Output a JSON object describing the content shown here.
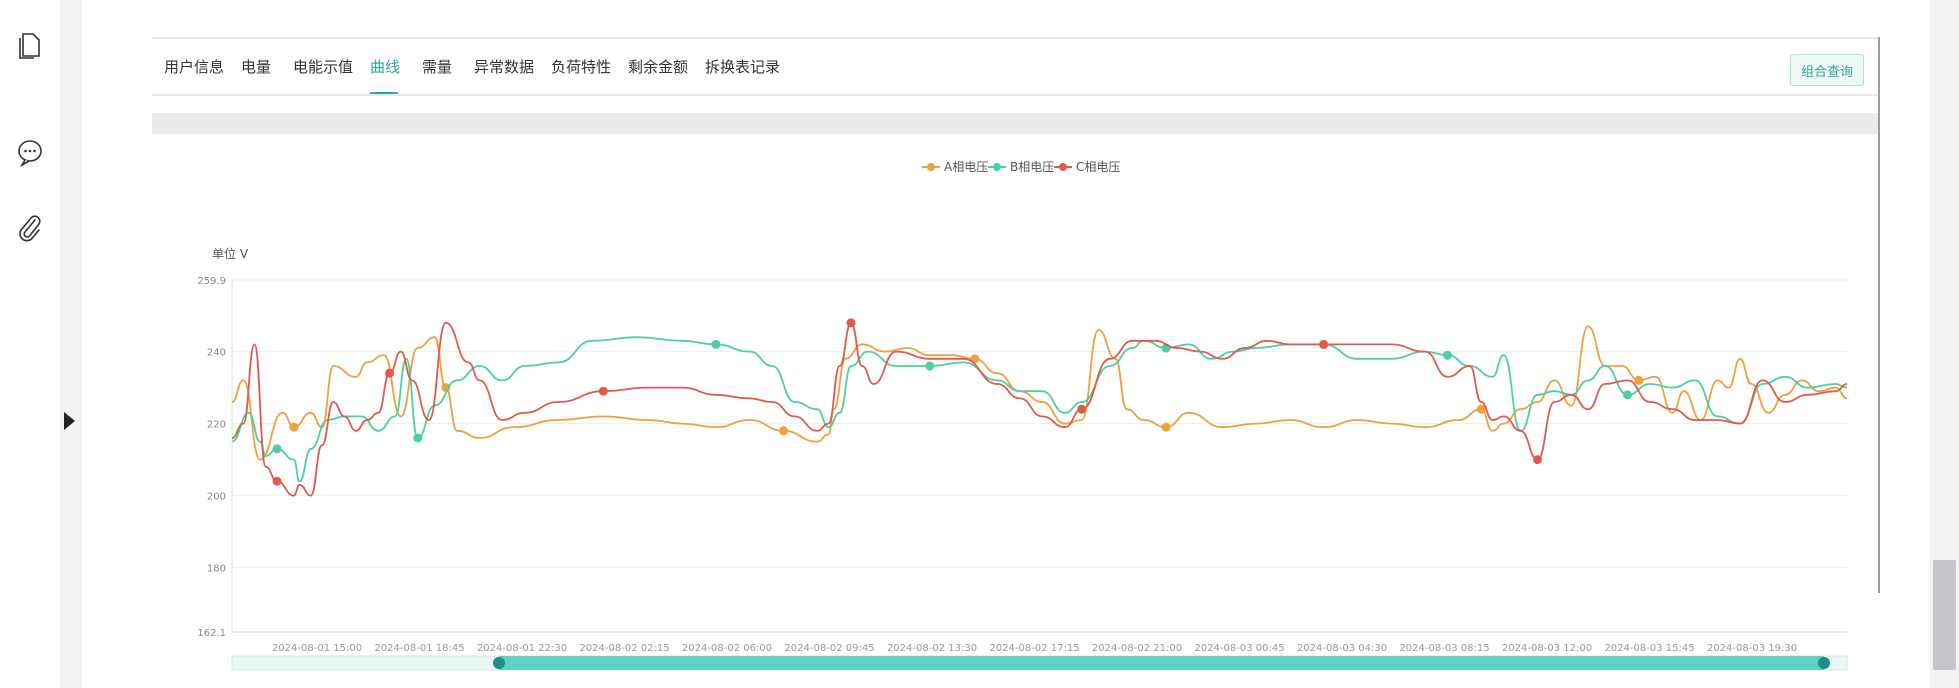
{
  "tabs": [
    {
      "label": "用户信息",
      "active": false
    },
    {
      "label": "电量",
      "active": false
    },
    {
      "label": "电能示值",
      "active": false
    },
    {
      "label": "曲线",
      "active": true
    },
    {
      "label": "需量",
      "active": false
    },
    {
      "label": "异常数据",
      "active": false
    },
    {
      "label": "负荷特性",
      "active": false
    },
    {
      "label": "剩余金额",
      "active": false
    },
    {
      "label": "拆换表记录",
      "active": false
    }
  ],
  "query_button": "组合查询",
  "rail_icons": [
    "document-icon",
    "chat-icon",
    "paperclip-icon"
  ],
  "colors": {
    "accent": "#2ea89c",
    "phase_a": "#f0a03c",
    "phase_b": "#4ccfa3",
    "phase_c": "#e05a4e"
  },
  "chart_data": {
    "type": "line",
    "unit_label": "单位 V",
    "ylim": [
      162.1,
      259.9
    ],
    "y_ticks": [
      "259.9",
      "240",
      "220",
      "200",
      "180",
      "162.1"
    ],
    "x_ticks": [
      "2024-08-01 15:00",
      "2024-08-01 18:45",
      "2024-08-01 22:30",
      "2024-08-02 02:15",
      "2024-08-02 06:00",
      "2024-08-02 09:45",
      "2024-08-02 13:30",
      "2024-08-02 17:15",
      "2024-08-02 21:00",
      "2024-08-03 00:45",
      "2024-08-03 04:30",
      "2024-08-03 08:15",
      "2024-08-03 12:00",
      "2024-08-03 15:45",
      "2024-08-03 19:30"
    ],
    "grid": true,
    "legend_position": "top-center",
    "series": [
      {
        "name": "A相电压",
        "color": "#f0a03c",
        "points": [
          [
            0,
            226
          ],
          [
            2,
            232
          ],
          [
            5,
            210
          ],
          [
            9,
            223
          ],
          [
            11,
            219
          ],
          [
            14,
            223
          ],
          [
            16,
            219
          ],
          [
            18,
            236
          ],
          [
            22,
            233
          ],
          [
            24,
            237
          ],
          [
            27,
            239
          ],
          [
            30,
            222
          ],
          [
            33,
            241
          ],
          [
            36,
            244
          ],
          [
            38,
            230
          ],
          [
            40,
            218
          ],
          [
            44,
            216
          ],
          [
            50,
            219
          ],
          [
            58,
            221
          ],
          [
            66,
            222
          ],
          [
            74,
            221
          ],
          [
            80,
            220
          ],
          [
            86,
            219
          ],
          [
            92,
            221
          ],
          [
            98,
            218
          ],
          [
            104,
            215
          ],
          [
            106,
            217
          ],
          [
            107,
            224
          ],
          [
            109,
            238
          ],
          [
            112,
            242
          ],
          [
            116,
            240
          ],
          [
            120,
            241
          ],
          [
            124,
            239
          ],
          [
            128,
            239
          ],
          [
            132,
            238
          ],
          [
            136,
            234
          ],
          [
            140,
            229
          ],
          [
            144,
            226
          ],
          [
            148,
            220
          ],
          [
            151,
            221
          ],
          [
            154,
            246
          ],
          [
            157,
            238
          ],
          [
            159,
            224
          ],
          [
            162,
            221
          ],
          [
            166,
            219
          ],
          [
            170,
            223
          ],
          [
            176,
            219
          ],
          [
            182,
            220
          ],
          [
            188,
            221
          ],
          [
            194,
            219
          ],
          [
            200,
            221
          ],
          [
            206,
            220
          ],
          [
            212,
            219
          ],
          [
            218,
            221
          ],
          [
            222,
            224
          ],
          [
            224,
            218
          ],
          [
            226,
            220
          ],
          [
            229,
            224
          ],
          [
            232,
            226
          ],
          [
            235,
            232
          ],
          [
            238,
            225
          ],
          [
            241,
            247
          ],
          [
            244,
            236
          ],
          [
            247,
            236
          ],
          [
            250,
            232
          ],
          [
            253,
            233
          ],
          [
            256,
            223
          ],
          [
            258,
            229
          ],
          [
            261,
            221
          ],
          [
            264,
            232
          ],
          [
            266,
            230
          ],
          [
            268,
            238
          ],
          [
            270,
            231
          ],
          [
            273,
            223
          ],
          [
            276,
            228
          ],
          [
            279,
            232
          ],
          [
            282,
            229
          ],
          [
            285,
            230
          ],
          [
            287,
            227
          ]
        ]
      },
      {
        "name": "B相电压",
        "color": "#4ccfa3",
        "points": [
          [
            0,
            215
          ],
          [
            3,
            223
          ],
          [
            5,
            215
          ],
          [
            6,
            211
          ],
          [
            8,
            213
          ],
          [
            11,
            210
          ],
          [
            12,
            204
          ],
          [
            14,
            213
          ],
          [
            17,
            221
          ],
          [
            20,
            222
          ],
          [
            23,
            222
          ],
          [
            26,
            218
          ],
          [
            29,
            222
          ],
          [
            31,
            238
          ],
          [
            33,
            216
          ],
          [
            36,
            225
          ],
          [
            40,
            232
          ],
          [
            44,
            236
          ],
          [
            48,
            232
          ],
          [
            52,
            236
          ],
          [
            58,
            237
          ],
          [
            64,
            243
          ],
          [
            72,
            244
          ],
          [
            80,
            243
          ],
          [
            86,
            242
          ],
          [
            92,
            240
          ],
          [
            96,
            236
          ],
          [
            100,
            226
          ],
          [
            104,
            224
          ],
          [
            106,
            219
          ],
          [
            108,
            223
          ],
          [
            110,
            236
          ],
          [
            113,
            240
          ],
          [
            118,
            236
          ],
          [
            124,
            236
          ],
          [
            130,
            237
          ],
          [
            136,
            232
          ],
          [
            140,
            229
          ],
          [
            144,
            229
          ],
          [
            148,
            223
          ],
          [
            151,
            226
          ],
          [
            156,
            236
          ],
          [
            160,
            241
          ],
          [
            162,
            243
          ],
          [
            166,
            241
          ],
          [
            170,
            242
          ],
          [
            174,
            238
          ],
          [
            178,
            240
          ],
          [
            182,
            241
          ],
          [
            188,
            242
          ],
          [
            194,
            242
          ],
          [
            200,
            238
          ],
          [
            206,
            238
          ],
          [
            212,
            240
          ],
          [
            216,
            239
          ],
          [
            220,
            236
          ],
          [
            224,
            233
          ],
          [
            226,
            239
          ],
          [
            229,
            218
          ],
          [
            232,
            228
          ],
          [
            235,
            229
          ],
          [
            238,
            228
          ],
          [
            241,
            232
          ],
          [
            244,
            236
          ],
          [
            248,
            228
          ],
          [
            252,
            231
          ],
          [
            256,
            230
          ],
          [
            260,
            232
          ],
          [
            264,
            222
          ],
          [
            268,
            220
          ],
          [
            272,
            231
          ],
          [
            276,
            233
          ],
          [
            280,
            230
          ],
          [
            285,
            231
          ],
          [
            287,
            230
          ]
        ]
      },
      {
        "name": "C相电压",
        "color": "#e05a4e",
        "points": [
          [
            0,
            216
          ],
          [
            2,
            220
          ],
          [
            4,
            242
          ],
          [
            6,
            208
          ],
          [
            8,
            204
          ],
          [
            11,
            200
          ],
          [
            12,
            203
          ],
          [
            14,
            200
          ],
          [
            16,
            214
          ],
          [
            18,
            226
          ],
          [
            20,
            222
          ],
          [
            22,
            218
          ],
          [
            24,
            221
          ],
          [
            26,
            223
          ],
          [
            28,
            234
          ],
          [
            30,
            240
          ],
          [
            32,
            232
          ],
          [
            35,
            221
          ],
          [
            38,
            248
          ],
          [
            42,
            237
          ],
          [
            44,
            232
          ],
          [
            48,
            221
          ],
          [
            52,
            223
          ],
          [
            58,
            226
          ],
          [
            66,
            229
          ],
          [
            74,
            230
          ],
          [
            80,
            230
          ],
          [
            86,
            228
          ],
          [
            92,
            227
          ],
          [
            96,
            226
          ],
          [
            100,
            222
          ],
          [
            104,
            218
          ],
          [
            106,
            220
          ],
          [
            108,
            236
          ],
          [
            110,
            248
          ],
          [
            112,
            236
          ],
          [
            114,
            231
          ],
          [
            118,
            240
          ],
          [
            124,
            238
          ],
          [
            130,
            238
          ],
          [
            136,
            231
          ],
          [
            140,
            227
          ],
          [
            144,
            222
          ],
          [
            148,
            219
          ],
          [
            151,
            224
          ],
          [
            156,
            238
          ],
          [
            160,
            243
          ],
          [
            164,
            243
          ],
          [
            168,
            241
          ],
          [
            172,
            240
          ],
          [
            176,
            238
          ],
          [
            180,
            241
          ],
          [
            184,
            243
          ],
          [
            188,
            242
          ],
          [
            194,
            242
          ],
          [
            200,
            242
          ],
          [
            206,
            242
          ],
          [
            212,
            240
          ],
          [
            216,
            233
          ],
          [
            220,
            236
          ],
          [
            222,
            226
          ],
          [
            224,
            221
          ],
          [
            226,
            222
          ],
          [
            229,
            218
          ],
          [
            232,
            210
          ],
          [
            235,
            226
          ],
          [
            238,
            228
          ],
          [
            241,
            224
          ],
          [
            244,
            231
          ],
          [
            248,
            232
          ],
          [
            252,
            226
          ],
          [
            256,
            224
          ],
          [
            260,
            221
          ],
          [
            264,
            221
          ],
          [
            268,
            220
          ],
          [
            272,
            232
          ],
          [
            276,
            226
          ],
          [
            280,
            228
          ],
          [
            285,
            229
          ],
          [
            287,
            231
          ]
        ]
      }
    ]
  }
}
